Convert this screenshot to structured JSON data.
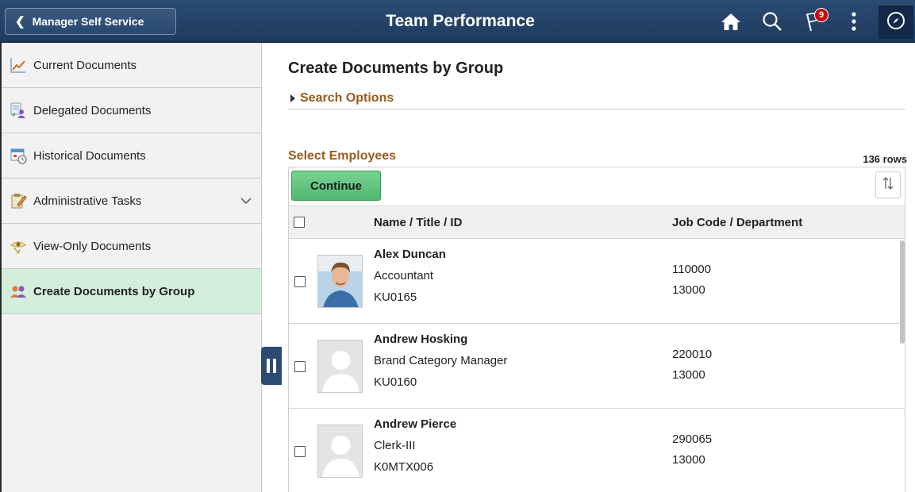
{
  "header": {
    "back_label": "Manager Self Service",
    "title": "Team Performance",
    "notification_count": "9",
    "icons": [
      "home-icon",
      "search-icon",
      "flag-icon",
      "more-icon",
      "navbar-compass-icon"
    ]
  },
  "sidebar": {
    "items": [
      {
        "label": "Current Documents",
        "icon": "line-chart-icon"
      },
      {
        "label": "Delegated Documents",
        "icon": "delegated-people-icon"
      },
      {
        "label": "Historical Documents",
        "icon": "calendar-clock-icon"
      },
      {
        "label": "Administrative Tasks",
        "icon": "clipboard-pencil-icon",
        "expandable": true
      },
      {
        "label": "View-Only Documents",
        "icon": "hand-eye-icon"
      },
      {
        "label": "Create Documents by Group",
        "icon": "group-people-icon",
        "active": true
      }
    ]
  },
  "main": {
    "title": "Create Documents by Group",
    "search_options": "Search Options",
    "section_title": "Select Employees",
    "row_count": "136 rows",
    "continue_label": "Continue",
    "columns": {
      "name": "Name / Title / ID",
      "job": "Job Code / Department"
    },
    "employees": [
      {
        "name": "Alex Duncan",
        "title": "Accountant",
        "id": "KU0165",
        "job_code": "110000",
        "department": "13000",
        "photo": "person-photo"
      },
      {
        "name": "Andrew Hosking",
        "title": "Brand Category Manager",
        "id": "KU0160",
        "job_code": "220010",
        "department": "13000",
        "photo": "placeholder-avatar"
      },
      {
        "name": "Andrew Pierce",
        "title": "Clerk-III",
        "id": "K0MTX006",
        "job_code": "290065",
        "department": "13000",
        "photo": "placeholder-avatar"
      }
    ]
  },
  "colors": {
    "banner": "#2c4c73",
    "accent_brown": "#9a5a1f",
    "active_nav": "#d3eedb",
    "continue_green": "#5cc07c",
    "badge_red": "#d00000"
  }
}
